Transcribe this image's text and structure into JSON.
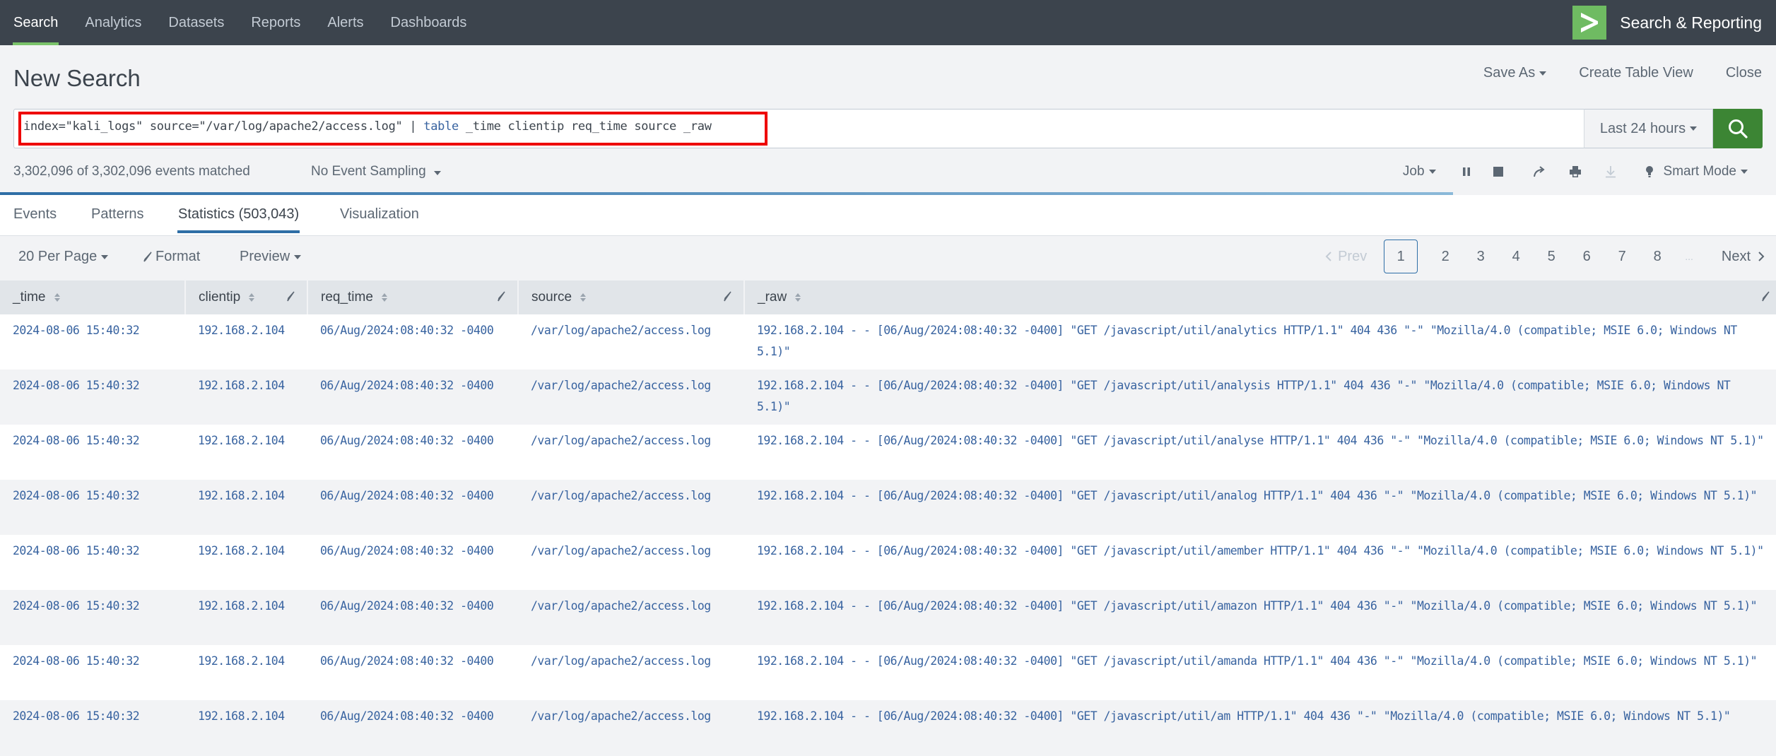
{
  "nav": {
    "items": [
      {
        "label": "Search",
        "active": true
      },
      {
        "label": "Analytics",
        "active": false
      },
      {
        "label": "Datasets",
        "active": false
      },
      {
        "label": "Reports",
        "active": false
      },
      {
        "label": "Alerts",
        "active": false
      },
      {
        "label": "Dashboards",
        "active": false
      }
    ],
    "app_title": "Search & Reporting",
    "logo_icon": "splunk-chevron-logo",
    "accent_color": "#7ac36a"
  },
  "header": {
    "title": "New Search",
    "save_as": "Save As",
    "create_table_view": "Create Table View",
    "close": "Close"
  },
  "search": {
    "query_prefix": "index=\"kali_logs\" source=\"/var/log/apache2/access.log\" | ",
    "query_keyword": "table",
    "query_suffix": " _time clientip req_time source _raw",
    "time_range": "Last 24 hours",
    "search_button_icon": "search-icon",
    "search_button_color": "#3c8534",
    "highlight_color": "#ee0000"
  },
  "status": {
    "events_matched": "3,302,096 of 3,302,096 events matched",
    "sampling": "No Event Sampling",
    "job_label": "Job",
    "mode": "Smart Mode",
    "progress_fraction": 0.818,
    "icons": [
      "pause-icon",
      "stop-icon",
      "share-icon",
      "print-icon",
      "export-icon",
      "lightbulb-icon"
    ]
  },
  "tabs": [
    {
      "label": "Events",
      "active": false
    },
    {
      "label": "Patterns",
      "active": false
    },
    {
      "label": "Statistics (503,043)",
      "active": true
    },
    {
      "label": "Visualization",
      "active": false
    }
  ],
  "toolbar": {
    "per_page": "20 Per Page",
    "format": "Format",
    "preview": "Preview"
  },
  "pagination": {
    "prev": "Prev",
    "pages": [
      "1",
      "2",
      "3",
      "4",
      "5",
      "6",
      "7",
      "8"
    ],
    "current": "1",
    "ellipsis": "...",
    "next": "Next"
  },
  "table": {
    "columns": [
      "_time",
      "clientip",
      "req_time",
      "source",
      "_raw"
    ],
    "rows": [
      {
        "_time": "2024-08-06 15:40:32",
        "clientip": "192.168.2.104",
        "req_time": "06/Aug/2024:08:40:32 -0400",
        "source": "/var/log/apache2/access.log",
        "_raw": "192.168.2.104 - - [06/Aug/2024:08:40:32 -0400] \"GET /javascript/util/analytics HTTP/1.1\" 404 436 \"-\" \"Mozilla/4.0 (compatible; MSIE 6.0; Windows NT 5.1)\""
      },
      {
        "_time": "2024-08-06 15:40:32",
        "clientip": "192.168.2.104",
        "req_time": "06/Aug/2024:08:40:32 -0400",
        "source": "/var/log/apache2/access.log",
        "_raw": "192.168.2.104 - - [06/Aug/2024:08:40:32 -0400] \"GET /javascript/util/analysis HTTP/1.1\" 404 436 \"-\" \"Mozilla/4.0 (compatible; MSIE 6.0; Windows NT 5.1)\""
      },
      {
        "_time": "2024-08-06 15:40:32",
        "clientip": "192.168.2.104",
        "req_time": "06/Aug/2024:08:40:32 -0400",
        "source": "/var/log/apache2/access.log",
        "_raw": "192.168.2.104 - - [06/Aug/2024:08:40:32 -0400] \"GET /javascript/util/analyse HTTP/1.1\" 404 436 \"-\" \"Mozilla/4.0 (compatible; MSIE 6.0; Windows NT 5.1)\""
      },
      {
        "_time": "2024-08-06 15:40:32",
        "clientip": "192.168.2.104",
        "req_time": "06/Aug/2024:08:40:32 -0400",
        "source": "/var/log/apache2/access.log",
        "_raw": "192.168.2.104 - - [06/Aug/2024:08:40:32 -0400] \"GET /javascript/util/analog HTTP/1.1\" 404 436 \"-\" \"Mozilla/4.0 (compatible; MSIE 6.0; Windows NT 5.1)\""
      },
      {
        "_time": "2024-08-06 15:40:32",
        "clientip": "192.168.2.104",
        "req_time": "06/Aug/2024:08:40:32 -0400",
        "source": "/var/log/apache2/access.log",
        "_raw": "192.168.2.104 - - [06/Aug/2024:08:40:32 -0400] \"GET /javascript/util/amember HTTP/1.1\" 404 436 \"-\" \"Mozilla/4.0 (compatible; MSIE 6.0; Windows NT 5.1)\""
      },
      {
        "_time": "2024-08-06 15:40:32",
        "clientip": "192.168.2.104",
        "req_time": "06/Aug/2024:08:40:32 -0400",
        "source": "/var/log/apache2/access.log",
        "_raw": "192.168.2.104 - - [06/Aug/2024:08:40:32 -0400] \"GET /javascript/util/amazon HTTP/1.1\" 404 436 \"-\" \"Mozilla/4.0 (compatible; MSIE 6.0; Windows NT 5.1)\""
      },
      {
        "_time": "2024-08-06 15:40:32",
        "clientip": "192.168.2.104",
        "req_time": "06/Aug/2024:08:40:32 -0400",
        "source": "/var/log/apache2/access.log",
        "_raw": "192.168.2.104 - - [06/Aug/2024:08:40:32 -0400] \"GET /javascript/util/amanda HTTP/1.1\" 404 436 \"-\" \"Mozilla/4.0 (compatible; MSIE 6.0; Windows NT 5.1)\""
      },
      {
        "_time": "2024-08-06 15:40:32",
        "clientip": "192.168.2.104",
        "req_time": "06/Aug/2024:08:40:32 -0400",
        "source": "/var/log/apache2/access.log",
        "_raw": "192.168.2.104 - - [06/Aug/2024:08:40:32 -0400] \"GET /javascript/util/am HTTP/1.1\" 404 436 \"-\" \"Mozilla/4.0 (compatible; MSIE 6.0; Windows NT 5.1)\""
      }
    ]
  }
}
